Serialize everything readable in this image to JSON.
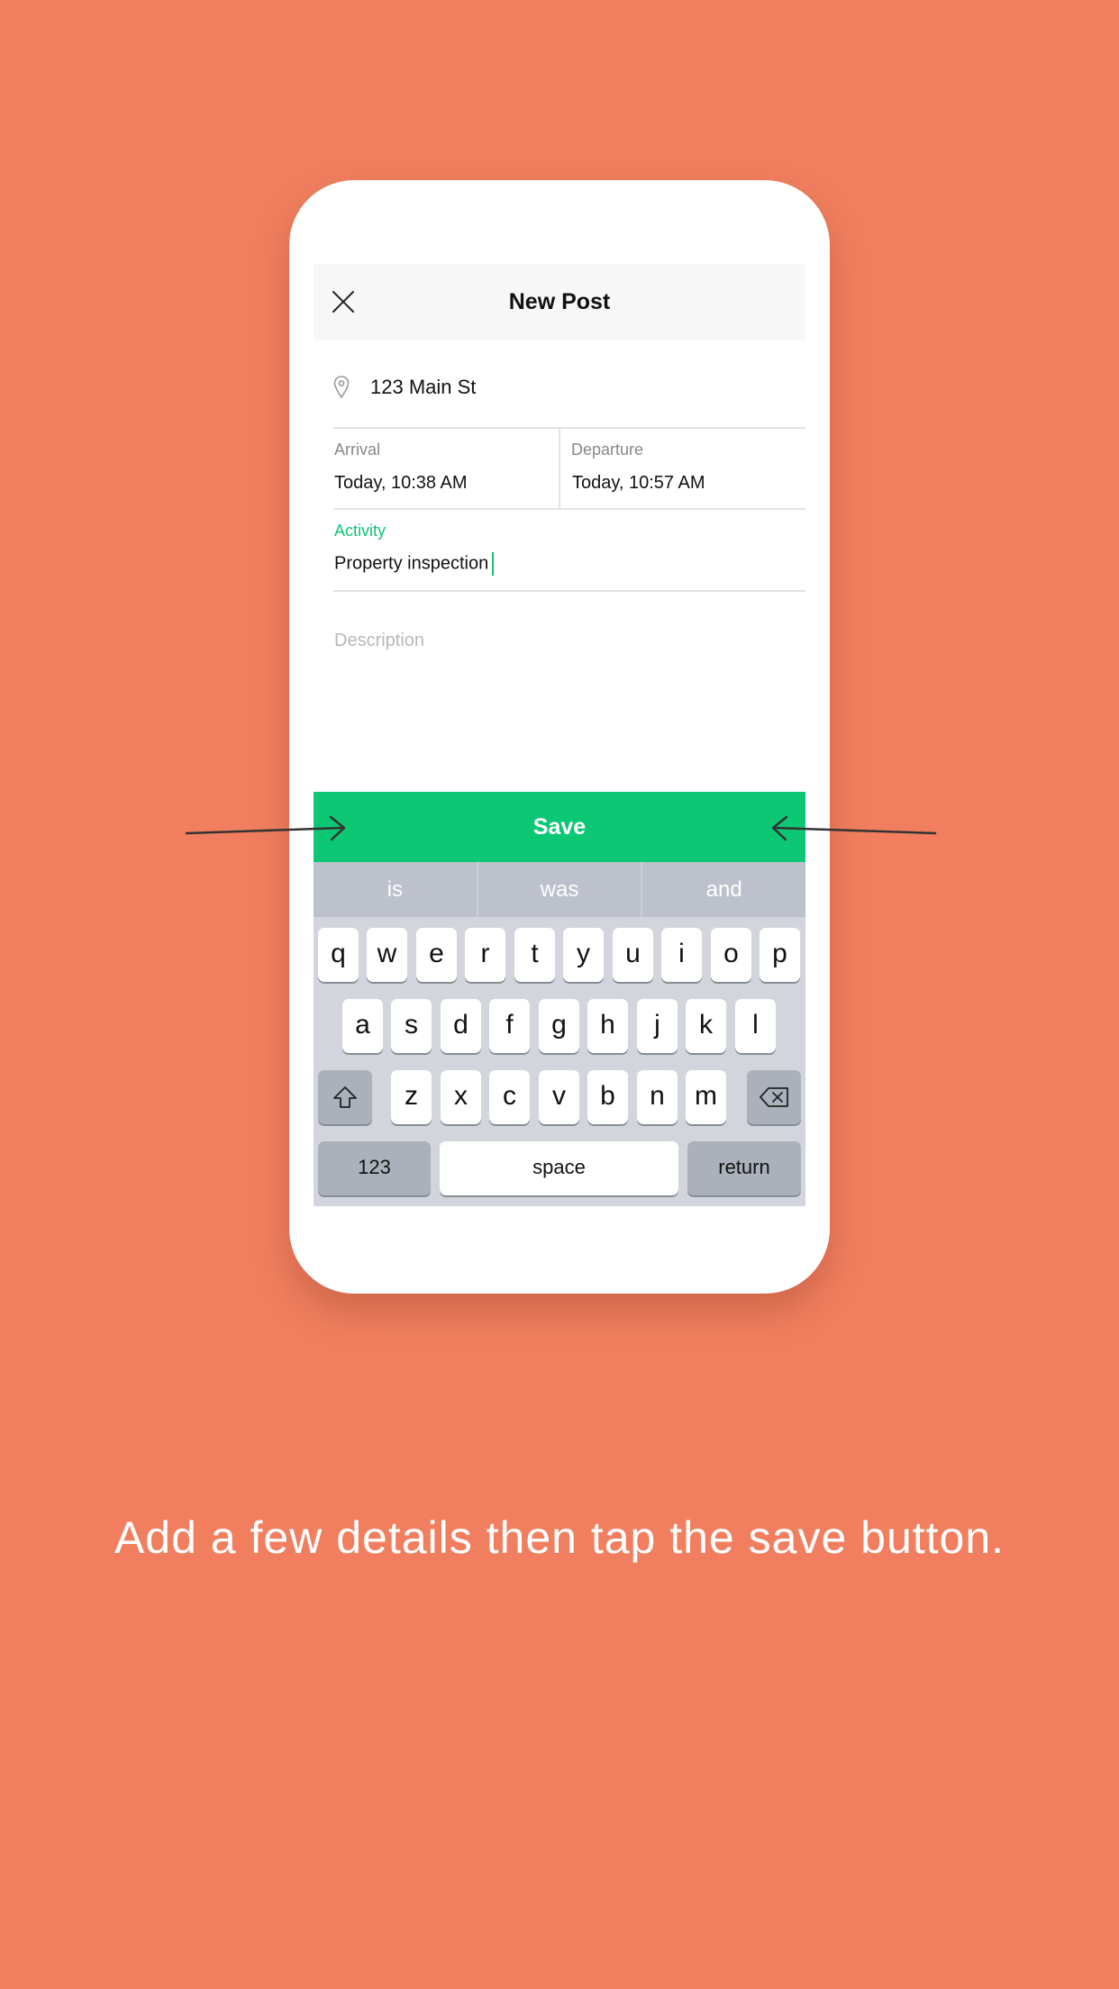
{
  "navbar": {
    "title": "New Post"
  },
  "location": {
    "value": "123 Main St"
  },
  "arrival": {
    "label": "Arrival",
    "value": "Today, 10:38 AM"
  },
  "departure": {
    "label": "Departure",
    "value": "Today, 10:57 AM"
  },
  "activity": {
    "label": "Activity",
    "value": "Property inspection"
  },
  "description": {
    "placeholder": "Description"
  },
  "save_label": "Save",
  "suggestions": [
    "is",
    "was",
    "and"
  ],
  "keyboard": {
    "row1": [
      "q",
      "w",
      "e",
      "r",
      "t",
      "y",
      "u",
      "i",
      "o",
      "p"
    ],
    "row2": [
      "a",
      "s",
      "d",
      "f",
      "g",
      "h",
      "j",
      "k",
      "l"
    ],
    "row3": [
      "z",
      "x",
      "c",
      "v",
      "b",
      "n",
      "m"
    ],
    "numbers_label": "123",
    "space_label": "space",
    "return_label": "return"
  },
  "caption": "Add a few details then tap the save button.",
  "colors": {
    "background": "#F17F5F",
    "accent": "#0CC774",
    "activity_label": "#12C277"
  }
}
